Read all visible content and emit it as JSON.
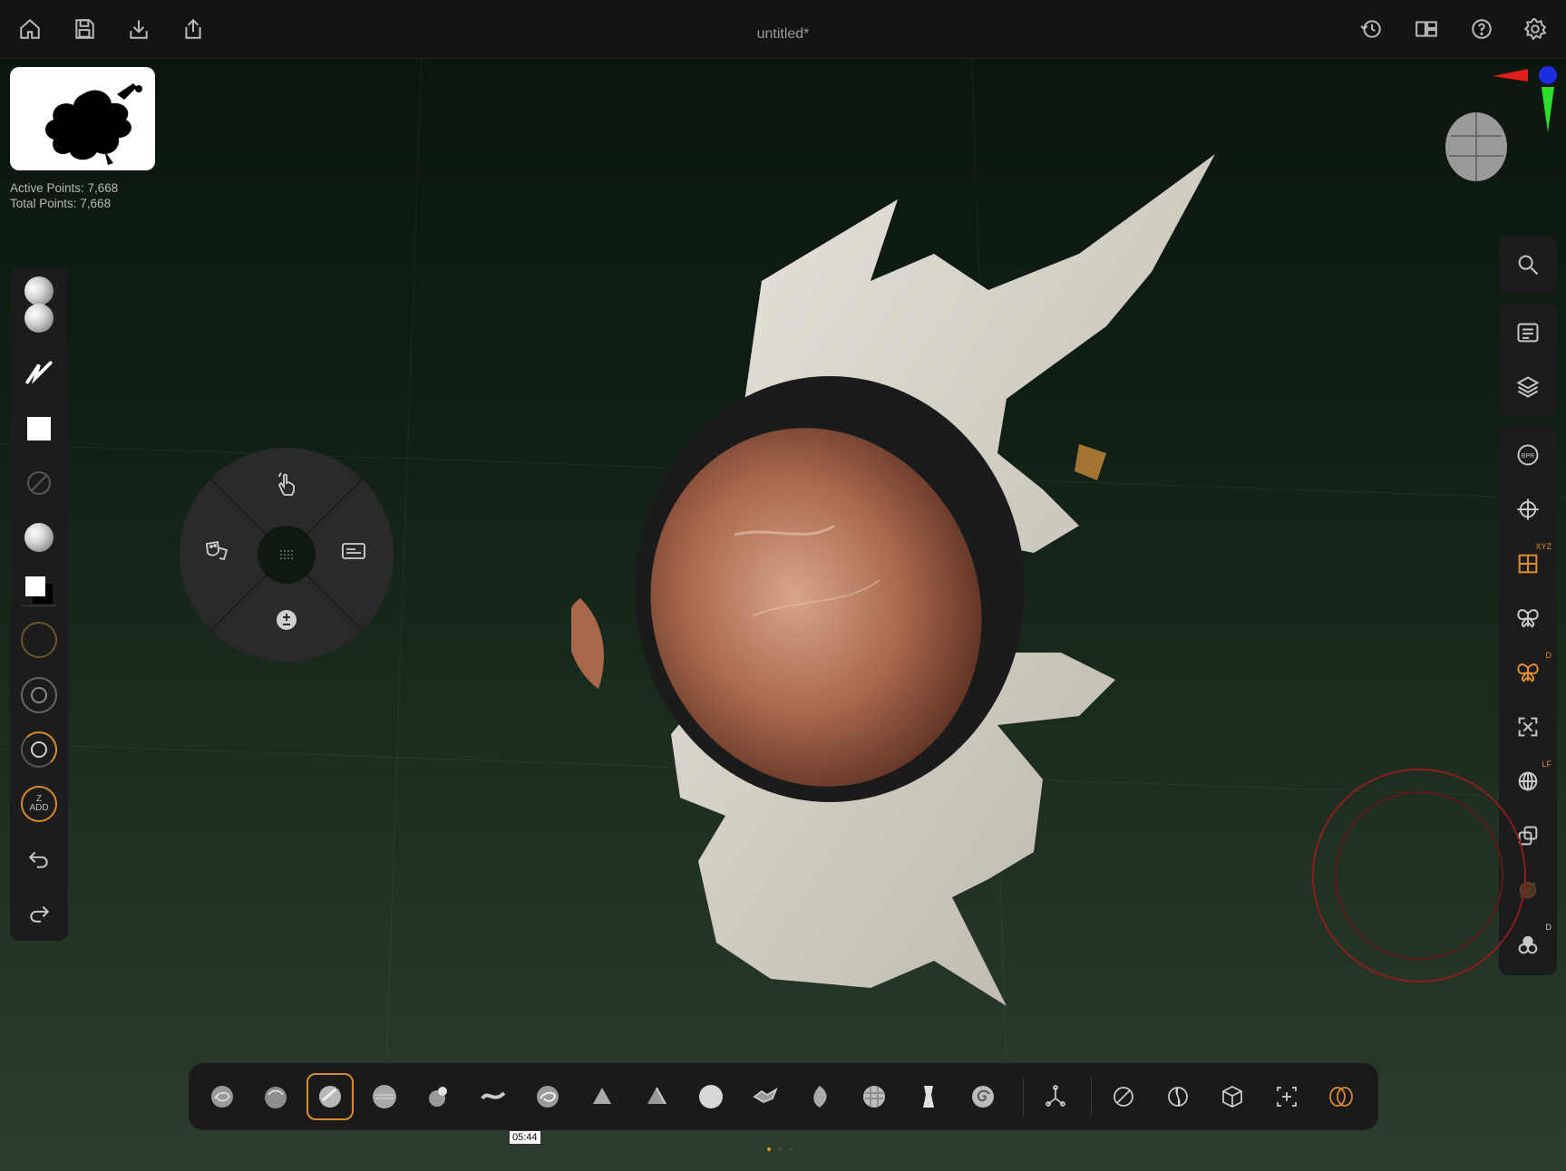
{
  "app": {
    "document_title": "untitled*"
  },
  "topbar": {
    "left_icons": [
      "home-icon",
      "save-icon",
      "import-icon",
      "share-icon"
    ],
    "right_icons": [
      "history-icon",
      "layout-icon",
      "help-icon",
      "settings-icon"
    ]
  },
  "stats": {
    "active_points": "Active Points: 7,668",
    "total_points": "Total Points: 7,668"
  },
  "left_toolbar": {
    "items": [
      "brush-preview",
      "stroke-icon",
      "alpha-preview",
      "texture-disabled",
      "material-sphere",
      "color-swatch",
      "draw-size-ring",
      "focal-shift-ring",
      "intensity-ring",
      "zadd-ring",
      "undo-icon",
      "redo-icon"
    ],
    "zadd_label": "Z\nADD"
  },
  "pie_menu": {
    "segments": [
      "gesture-icon",
      "masks-icon",
      "panel-icon",
      "subtool-add-icon"
    ]
  },
  "right_toolbar": {
    "group1": [
      "search-icon"
    ],
    "group2": [
      "tool-list-icon",
      "layers-icon"
    ],
    "group3": [
      "bpr-icon",
      "move-gizmo-icon",
      "xyz-symmetry-icon",
      "symmetry-icon",
      "radial-symmetry-icon",
      "frame-icon",
      "local-transform-icon",
      "polyframe-icon",
      "solo-icon",
      "spotlight-icon"
    ],
    "labels": {
      "bpr": "BPR",
      "xyz": "XYZ",
      "d_sym": "D",
      "lf": "LF",
      "d_last": "D"
    }
  },
  "bottom_bar": {
    "brushes": [
      "move-brush",
      "clay-buildup-brush",
      "standard-brush",
      "smooth-brush",
      "inflate-brush",
      "dam-standard-brush",
      "snakehook-brush",
      "trim-dynamic-brush",
      "hpolish-brush",
      "flatten-brush",
      "chisel-brush",
      "pinch-brush",
      "curve-tube-brush",
      "imm-brush",
      "spiral-brush"
    ],
    "selected_index": 2,
    "actions": [
      "transpose-icon",
      "mask-icon",
      "dynamesh-icon",
      "subdivide-icon",
      "insert-icon",
      "polish-icon"
    ]
  },
  "tooltip": {
    "text": "05:44"
  },
  "colors": {
    "accent": "#e08e2e",
    "panel": "#1c1c1c",
    "topbar": "#141414"
  }
}
